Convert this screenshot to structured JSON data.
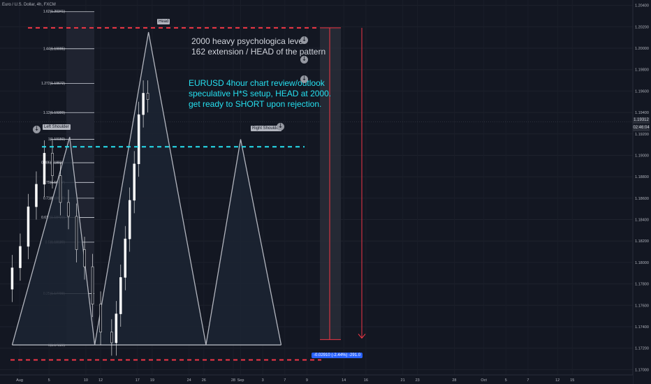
{
  "symbol_title": "Euro / U.S. Dollar, 4h, FXCM",
  "notes": {
    "white_lines": [
      "2000 heavy psychologica level",
      "162 extension / HEAD of the pattern"
    ],
    "cyan_lines": [
      "EURUSD 4hour chart review/outlook",
      "speculative H*S setup, HEAD at 2000.",
      "get ready to SHORT upon rejection."
    ]
  },
  "pattern_labels": {
    "left_shoulder": "Left Shoulder",
    "head": "Head",
    "right_shoulder": "Right Shoulder"
  },
  "price_axis": {
    "current_price": "1.19312",
    "countdown": "02:46:04",
    "tag_colors": {
      "current": "#2a2e39",
      "countdown": "#2a2e39"
    }
  },
  "measure": {
    "label": "-0.02910 (-2.44%) -291.0"
  },
  "colors": {
    "background": "#131722",
    "red_line": "#f23645",
    "cyan_line": "#26e0f0",
    "pattern_line": "#b2b5be",
    "pattern_fill": "#1c2433",
    "candle": "#ffffff",
    "fib_line": "#d1d4dc",
    "text": "#b2b5be"
  },
  "icons": [
    "download-icon",
    "download-icon",
    "download-icon",
    "download-icon",
    "download-icon"
  ],
  "chart_data": {
    "type": "line",
    "title": "Euro / U.S. Dollar, 4h, FXCM",
    "xlabel": "",
    "ylabel": "",
    "ylim": [
      1.1695,
      1.2045
    ],
    "y_ticks": [
      1.17,
      1.172,
      1.174,
      1.176,
      1.178,
      1.18,
      1.182,
      1.184,
      1.186,
      1.188,
      1.19,
      1.192,
      1.194,
      1.196,
      1.198,
      1.2,
      1.202,
      1.204
    ],
    "y_tick_labels": [
      "1.17000",
      "1.17200",
      "1.17400",
      "1.17600",
      "1.17800",
      "1.18000",
      "1.18200",
      "1.18400",
      "1.18600",
      "1.18800",
      "1.19000",
      "1.19200",
      "1.19400",
      "1.19600",
      "1.19800",
      "1.20000",
      "1.20200",
      "1.20400"
    ],
    "x_ticks": [
      {
        "day": 0,
        "label": "Aug"
      },
      {
        "day": 4,
        "label": "5"
      },
      {
        "day": 9,
        "label": "10"
      },
      {
        "day": 11,
        "label": "12"
      },
      {
        "day": 16,
        "label": "17"
      },
      {
        "day": 18,
        "label": "19"
      },
      {
        "day": 23,
        "label": "24"
      },
      {
        "day": 25,
        "label": "26"
      },
      {
        "day": 29,
        "label": "28"
      },
      {
        "day": 30,
        "label": "Sep"
      },
      {
        "day": 33,
        "label": "3"
      },
      {
        "day": 36,
        "label": "7"
      },
      {
        "day": 39,
        "label": "9"
      },
      {
        "day": 44,
        "label": "14"
      },
      {
        "day": 47,
        "label": "16"
      },
      {
        "day": 52,
        "label": "21"
      },
      {
        "day": 54,
        "label": "23"
      },
      {
        "day": 59,
        "label": "28"
      },
      {
        "day": 63,
        "label": "Oct"
      },
      {
        "day": 66,
        "label": "5"
      },
      {
        "day": 69,
        "label": "7"
      },
      {
        "day": 73,
        "label": "12"
      },
      {
        "day": 75,
        "label": "15"
      }
    ],
    "fib_levels": [
      {
        "label": "1.62(1.20341)",
        "value": 1.20341
      },
      {
        "label": "1.44(1.19995)",
        "value": 1.19995
      },
      {
        "label": "1.272(1.19672)",
        "value": 1.19672
      },
      {
        "label": "1.13(1.19399)",
        "value": 1.19399
      },
      {
        "label": "1(1.19150)",
        "value": 1.1915
      },
      {
        "label": "0.886(1.18931)",
        "value": 1.18931
      },
      {
        "label": "0.79(1.18747)",
        "value": 1.18747
      },
      {
        "label": "0.71(1.18600)",
        "value": 1.186
      },
      {
        "label": "0.618(1.18420)",
        "value": 1.1842
      },
      {
        "label": "0.5(1.18189)",
        "value": 1.18189
      },
      {
        "label": "0.25(1.17709)",
        "value": 1.17709
      },
      {
        "label": "0(1.17229)",
        "value": 1.17229
      }
    ],
    "horizontal_lines": [
      {
        "name": "resistance",
        "value": 1.2019,
        "style": "dashed-red"
      },
      {
        "name": "support",
        "value": 1.1709,
        "style": "dashed-red"
      },
      {
        "name": "neckline",
        "value": 1.1908,
        "style": "dashed-cyan"
      }
    ],
    "head_and_shoulders": {
      "points": [
        {
          "day": -1,
          "value": 1.1723
        },
        {
          "day": 6.8,
          "value": 1.1917
        },
        {
          "day": 10.2,
          "value": 1.1723
        },
        {
          "day": 17.5,
          "value": 1.2015
        },
        {
          "day": 25.3,
          "value": 1.1723
        },
        {
          "day": 30,
          "value": 1.1915
        },
        {
          "day": 35.5,
          "value": 1.1723
        }
      ],
      "base_start_day": -1,
      "base_end_day": 35.5
    },
    "candles_close": [
      1.1795,
      1.1815,
      1.1852,
      1.1873,
      1.1902,
      1.1881,
      1.1856,
      1.1843,
      1.1812,
      1.1796,
      1.1761,
      1.1735,
      1.1725,
      1.1752,
      1.1786,
      1.1822,
      1.1858,
      1.1892,
      1.1938,
      1.1958,
      1.1952
    ],
    "current_price": 1.19312,
    "measure": {
      "from": 1.2019,
      "to": 1.1728,
      "label": "-0.02910 (-2.44%) -291.0"
    }
  }
}
